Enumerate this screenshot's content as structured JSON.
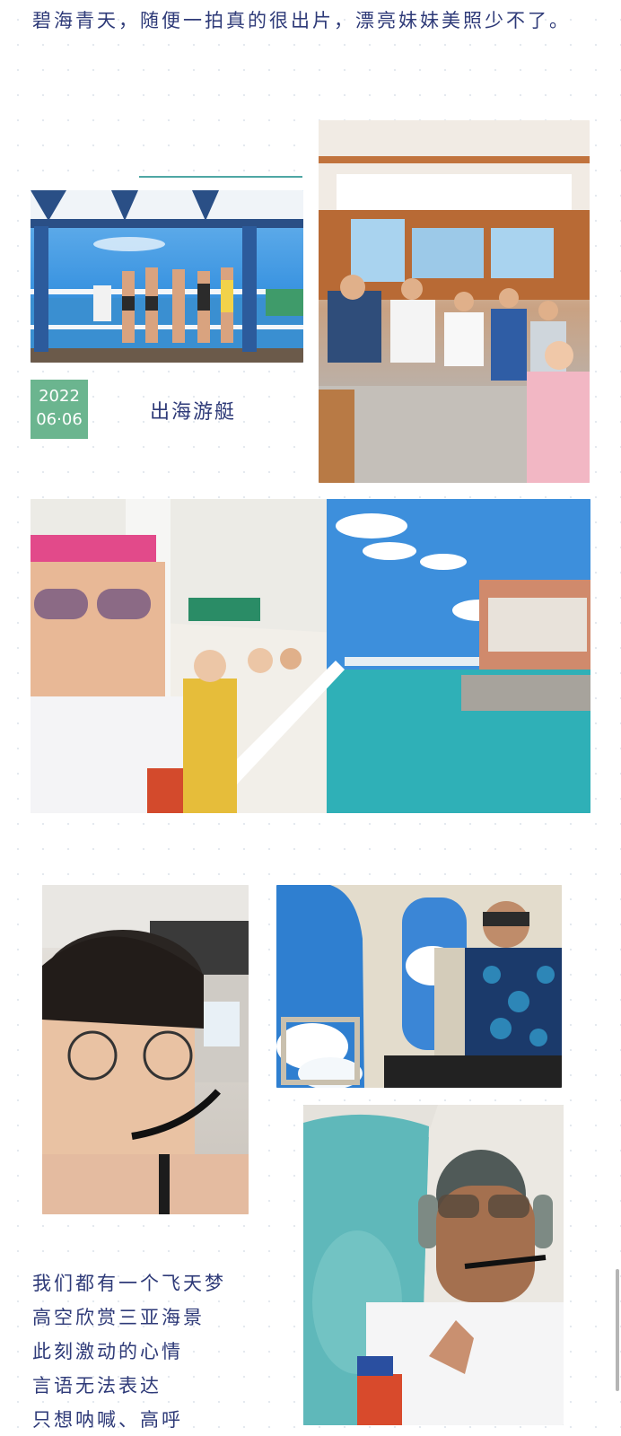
{
  "intro_text": "碧海青天，随便一拍真的很出片，漂亮妹妹美照少不了。",
  "date_badge": {
    "year": "2022",
    "day": "06·06"
  },
  "caption": "出海游艇",
  "poem_lines": [
    "我们都有一个飞天梦",
    "高空欣赏三亚海景",
    "此刻激动的心情",
    "言语无法表达",
    "只想呐喊、高呼"
  ],
  "colors": {
    "text": "#2e3a78",
    "badge": "#6bb58f",
    "rule": "#4fa7a4",
    "sea": "#2fb0b7",
    "sky": "#3c95e1"
  }
}
